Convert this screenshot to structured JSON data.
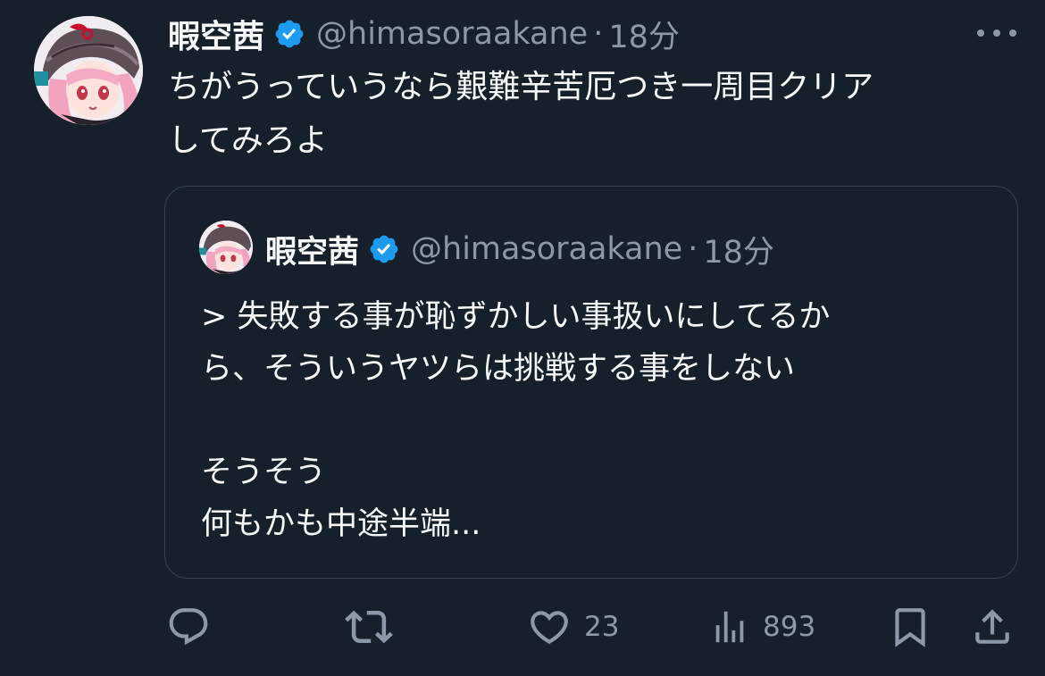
{
  "tweet": {
    "display_name": "暇空茜",
    "handle": "@himasoraakane",
    "separator": "·",
    "time": "18分",
    "text_lines": [
      "ちがうっていうなら艱難辛苦厄つき一周目クリア",
      "してみろよ"
    ]
  },
  "quote": {
    "display_name": "暇空茜",
    "handle": "@himasoraakane",
    "separator": "·",
    "time": "18分",
    "text_lines": [
      "> 失敗する事が恥ずかしい事扱いにしてるか",
      "ら、そういうヤツらは挑戦する事をしない",
      "",
      "そうそう",
      "何もかも中途半端..."
    ]
  },
  "actions": {
    "reply_icon": "reply-icon",
    "retweet_icon": "retweet-icon",
    "like_icon": "heart-icon",
    "like_count": "23",
    "views_icon": "views-icon",
    "views_count": "893",
    "bookmark_icon": "bookmark-icon",
    "share_icon": "share-icon"
  },
  "colors": {
    "background": "#15202b",
    "text": "#f7f9f9",
    "muted": "#8b98a5",
    "verified": "#1d9bf0",
    "border": "#38444d"
  }
}
